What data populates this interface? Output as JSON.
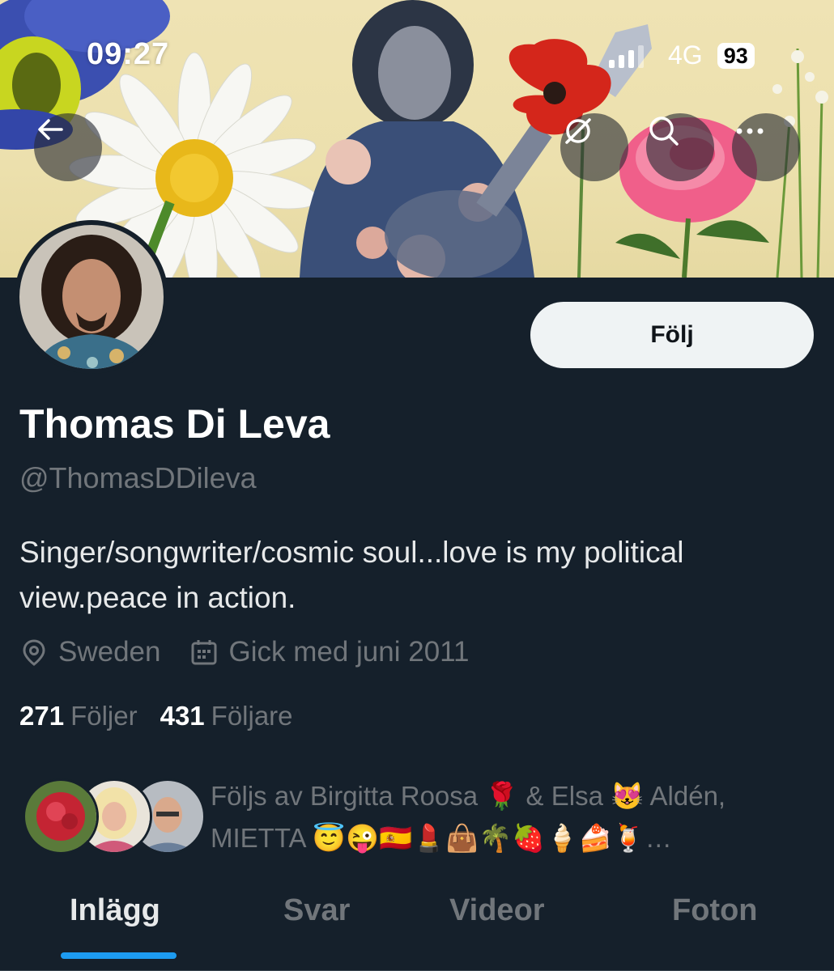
{
  "status_bar": {
    "time": "09:27",
    "network": "4G",
    "battery": "93"
  },
  "banner": {
    "nav_buttons": [
      "back-arrow-icon",
      "no-sync-icon",
      "search-icon",
      "more-icon"
    ]
  },
  "profile": {
    "follow_label": "Följ",
    "name": "Thomas Di Leva",
    "handle": "@ThomasDDileva",
    "bio": "Singer/songwriter/cosmic soul...love is my political view.peace in action.",
    "location": "Sweden",
    "joined": "Gick med juni 2011",
    "following_count": "271",
    "following_label": "Följer",
    "followers_count": "431",
    "followers_label": "Följare",
    "followed_by_text": "Följs av Birgitta Roosa 🌹 & Elsa 😻 Aldén, MIETTA 😇😜🇪🇸💄👜🌴🍓🍦🍰🍹…"
  },
  "tabs": [
    {
      "label": "Inlägg",
      "active": true
    },
    {
      "label": "Svar",
      "active": false
    },
    {
      "label": "Videor",
      "active": false
    },
    {
      "label": "Foton",
      "active": false
    }
  ],
  "colors": {
    "background": "#15202b",
    "accent": "#1d9bf0",
    "muted_text": "#71767b",
    "follow_button": "#eff3f4"
  }
}
